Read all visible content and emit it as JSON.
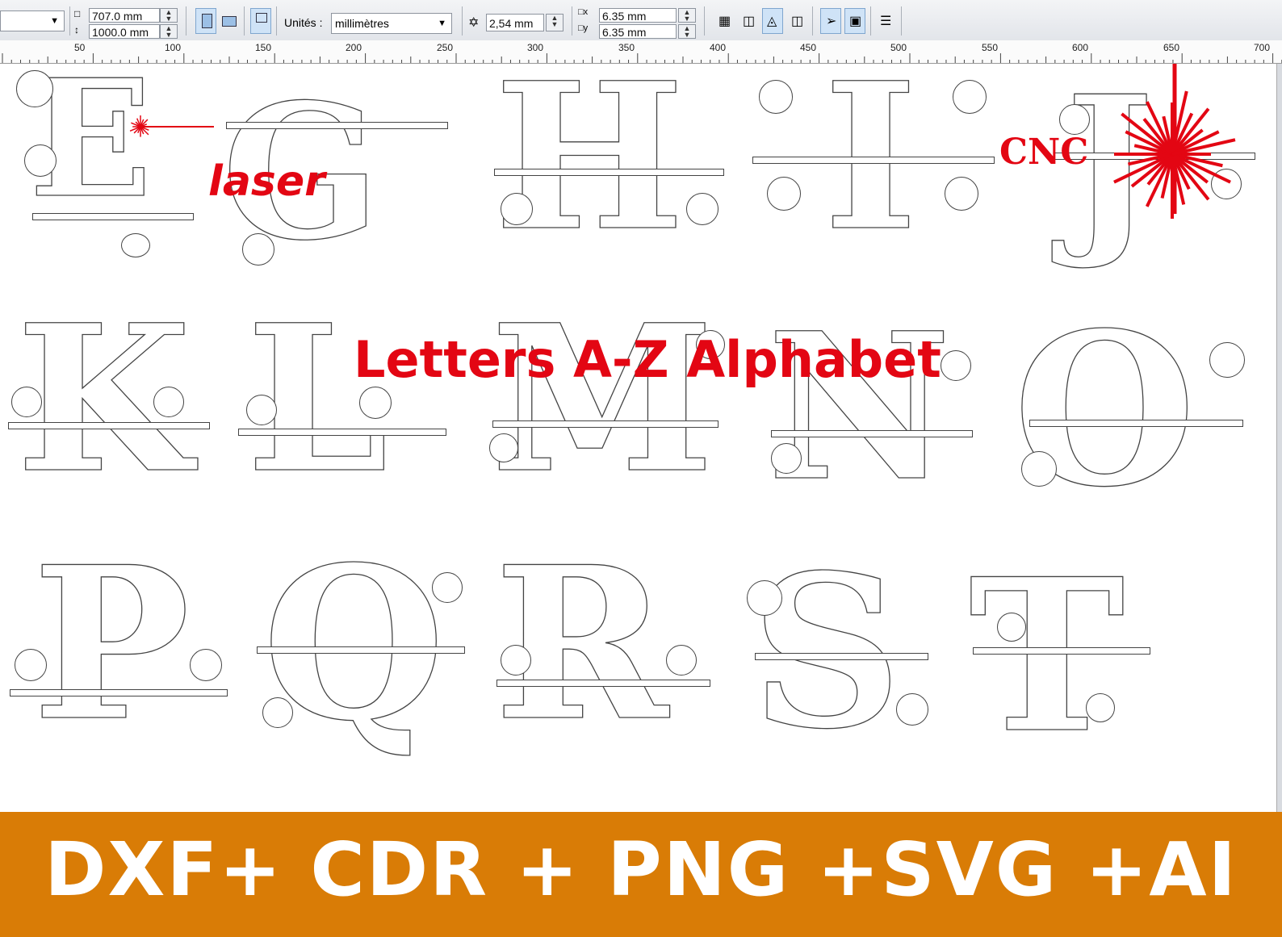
{
  "toolbar": {
    "width_value": "707.0 mm",
    "height_value": "1000.0 mm",
    "units_label": "Unités :",
    "units_selected": "millimètres",
    "nudge_value": "2,54 mm",
    "dup_x_value": "6.35 mm",
    "dup_y_value": "6.35 mm"
  },
  "ruler": {
    "ticks": [
      "50",
      "100",
      "150",
      "200",
      "250",
      "300",
      "350",
      "400",
      "450",
      "500",
      "550",
      "600",
      "650",
      "700"
    ]
  },
  "canvas": {
    "title": "Letters A-Z Alphabet",
    "cnc_label": "CNC",
    "laser_label": "laser",
    "letters_row1": [
      "E",
      "G",
      "H",
      "I",
      "J"
    ],
    "letters_row2": [
      "K",
      "L",
      "M",
      "N",
      "O"
    ],
    "letters_row3": [
      "P",
      "Q",
      "R",
      "S",
      "T"
    ]
  },
  "banner": {
    "text": "DXF+ CDR + PNG +SVG +AI"
  },
  "colors": {
    "accent_red": "#e30613",
    "banner_orange": "#d97c06"
  }
}
